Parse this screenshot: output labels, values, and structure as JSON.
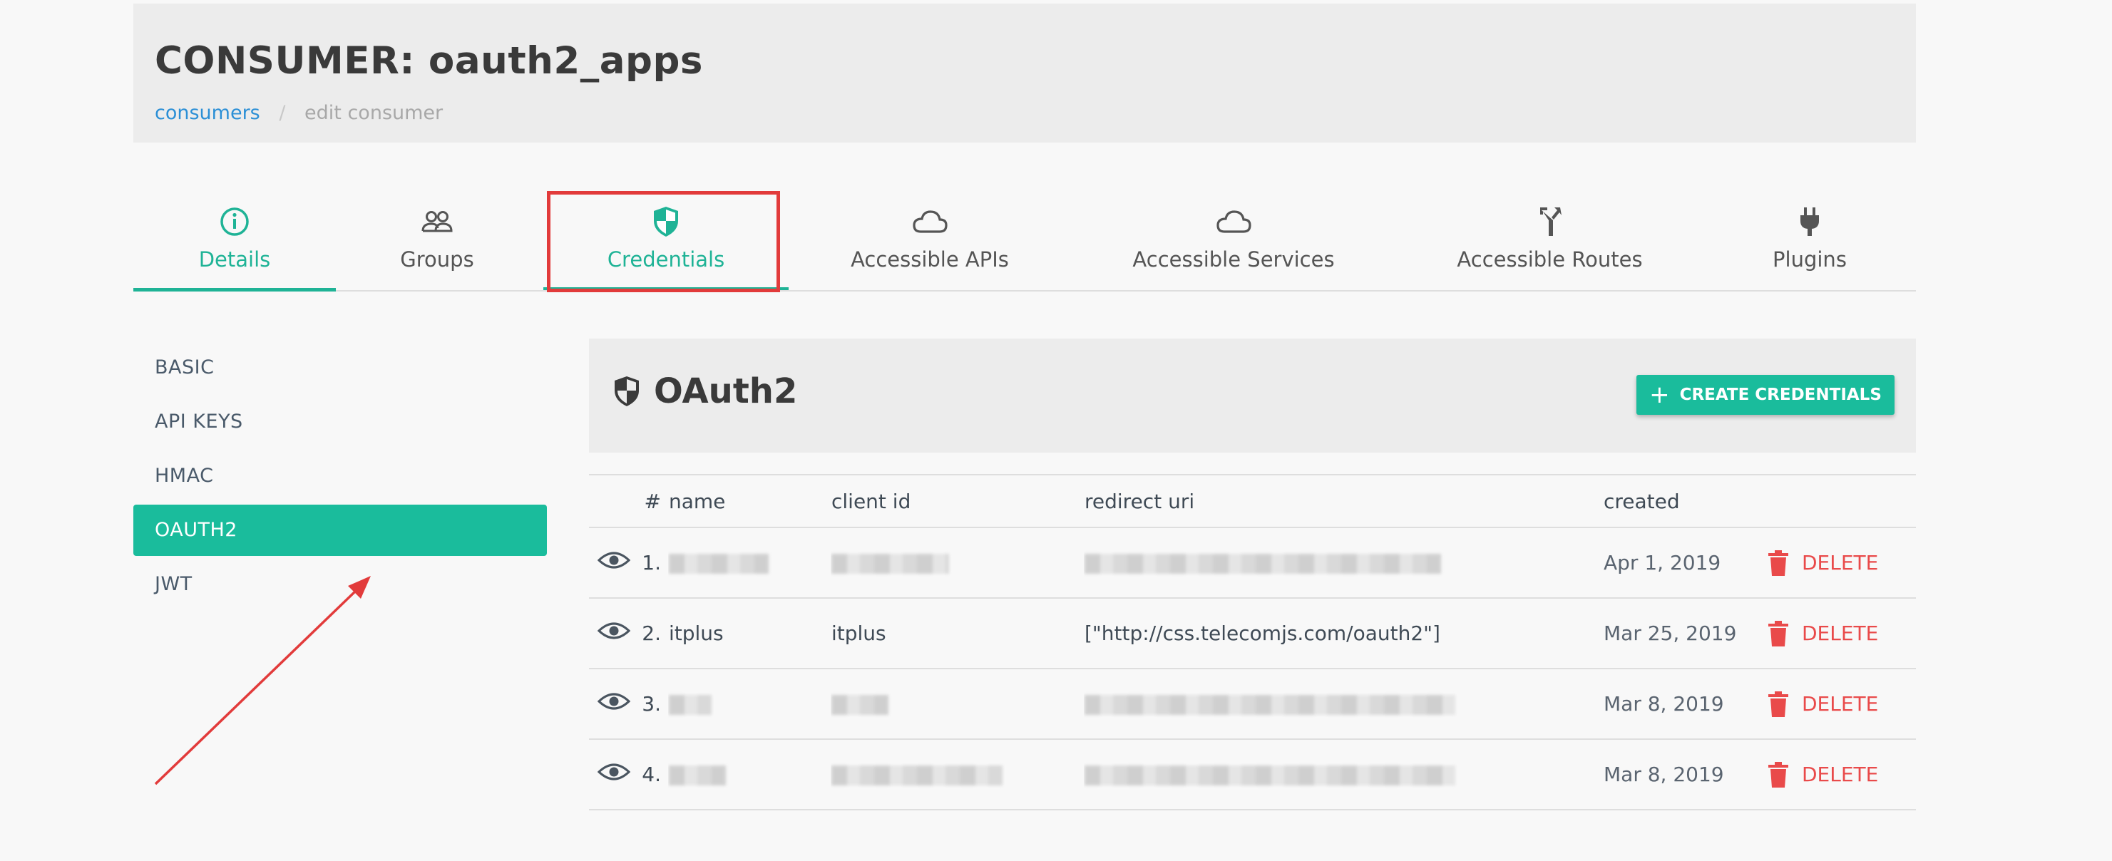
{
  "header": {
    "title": "CONSUMER: oauth2_apps",
    "breadcrumb": {
      "parent": "consumers",
      "separator": "/",
      "current": "edit consumer"
    }
  },
  "tabs": [
    {
      "label": "Details",
      "icon": "info-circle-icon"
    },
    {
      "label": "Groups",
      "icon": "people-icon"
    },
    {
      "label": "Credentials",
      "icon": "shield-icon"
    },
    {
      "label": "Accessible APIs",
      "icon": "cloud-icon"
    },
    {
      "label": "Accessible Services",
      "icon": "cloud-icon"
    },
    {
      "label": "Accessible Routes",
      "icon": "fork-icon"
    },
    {
      "label": "Plugins",
      "icon": "plug-icon"
    }
  ],
  "side_menu": {
    "items": [
      "BASIC",
      "API KEYS",
      "HMAC",
      "OAUTH2",
      "JWT"
    ],
    "active": "OAUTH2"
  },
  "panel": {
    "title": "OAuth2",
    "create_button": "CREATE CREDENTIALS"
  },
  "table": {
    "headers": {
      "num": "#",
      "name": "name",
      "client_id": "client id",
      "redirect_uri": "redirect uri",
      "created": "created"
    },
    "rows": [
      {
        "num": "1.",
        "name": "",
        "client_id": "",
        "redirect_uri": "",
        "created": "Apr 1, 2019",
        "delete": "DELETE",
        "redacted": true
      },
      {
        "num": "2.",
        "name": "itplus",
        "client_id": "itplus",
        "redirect_uri": "[\"http://css.telecomjs.com/oauth2\"]",
        "created": "Mar 25, 2019",
        "delete": "DELETE",
        "redacted": false
      },
      {
        "num": "3.",
        "name": "",
        "client_id": "",
        "redirect_uri": "",
        "created": "Mar 8, 2019",
        "delete": "DELETE",
        "redacted": true
      },
      {
        "num": "4.",
        "name": "",
        "client_id": "",
        "redirect_uri": "",
        "created": "Mar 8, 2019",
        "delete": "DELETE",
        "redacted": true
      }
    ]
  },
  "colors": {
    "accent": "#1abc9c",
    "danger": "#e94a4a",
    "annotation": "#e23b3b",
    "link": "#2b8fd6"
  }
}
